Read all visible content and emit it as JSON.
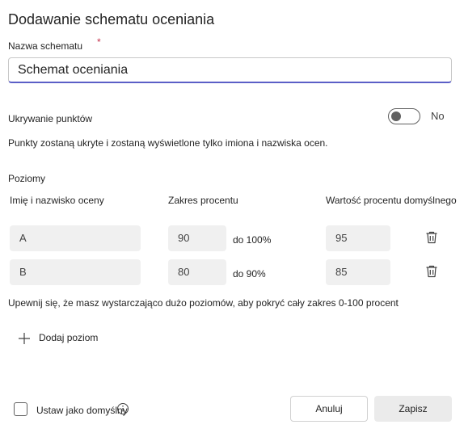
{
  "dialog": {
    "title": "Dodawanie schematu oceniania"
  },
  "name_field": {
    "label": "Nazwa schematu",
    "required_marker": "*",
    "value": "Schemat oceniania"
  },
  "hide_points": {
    "label": "Ukrywanie punktów",
    "toggle_state": "No",
    "description": "Punkty zostaną ukryte i zostaną wyświetlone tylko imiona i nazwiska ocen."
  },
  "levels": {
    "section_label": "Poziomy",
    "columns": {
      "name": "Imię i nazwisko oceny",
      "range": "Zakres procentu",
      "default": "Wartość procentu domyślnego"
    },
    "rows": [
      {
        "name": "A",
        "range_from": "90",
        "range_to": "do 100%",
        "default": "95"
      },
      {
        "name": "B",
        "range_from": "80",
        "range_to": "do 90%",
        "default": "85"
      }
    ],
    "coverage_hint": "Upewnij się, że masz wystarczająco dużo poziomów, aby pokryć cały zakres 0-100 procent",
    "add_label": "Dodaj poziom"
  },
  "footer": {
    "default_checkbox_label": "Ustaw jako domyślny",
    "cancel_label": "Anuluj",
    "save_label": "Zapisz"
  },
  "icons": {
    "delete": "trash-icon",
    "add": "plus-icon",
    "info": "info-icon"
  },
  "colors": {
    "accent": "#5b5fc7",
    "required": "#c4314b",
    "field_background": "#f0f0f0"
  }
}
